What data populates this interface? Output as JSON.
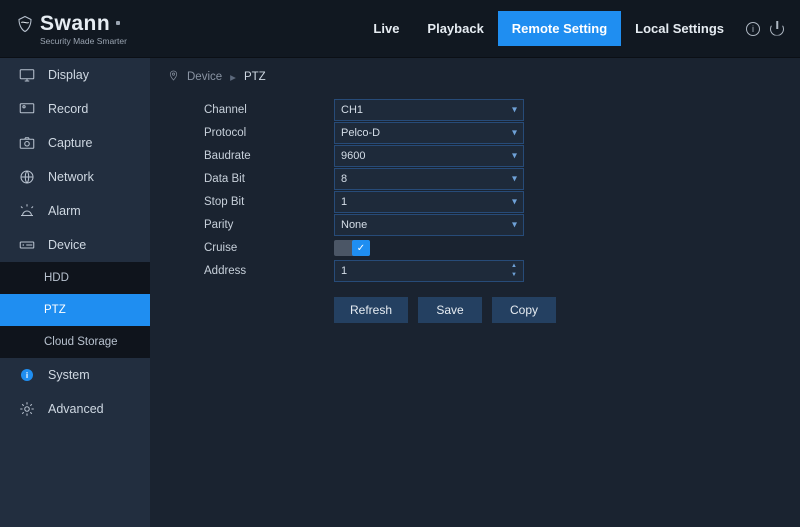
{
  "brand": {
    "name": "Swann",
    "tagline": "Security Made Smarter"
  },
  "topnav": {
    "live": "Live",
    "playback": "Playback",
    "remote": "Remote Setting",
    "local": "Local Settings"
  },
  "sidebar": {
    "display": "Display",
    "record": "Record",
    "capture": "Capture",
    "network": "Network",
    "alarm": "Alarm",
    "device": "Device",
    "device_sub": {
      "hdd": "HDD",
      "ptz": "PTZ",
      "cloud": "Cloud Storage"
    },
    "system": "System",
    "advanced": "Advanced"
  },
  "breadcrumb": {
    "root": "Device",
    "leaf": "PTZ"
  },
  "form": {
    "labels": {
      "channel": "Channel",
      "protocol": "Protocol",
      "baudrate": "Baudrate",
      "databit": "Data Bit",
      "stopbit": "Stop Bit",
      "parity": "Parity",
      "cruise": "Cruise",
      "address": "Address"
    },
    "values": {
      "channel": "CH1",
      "protocol": "Pelco-D",
      "baudrate": "9600",
      "databit": "8",
      "stopbit": "1",
      "parity": "None",
      "cruise": true,
      "address": "1"
    }
  },
  "buttons": {
    "refresh": "Refresh",
    "save": "Save",
    "copy": "Copy"
  }
}
